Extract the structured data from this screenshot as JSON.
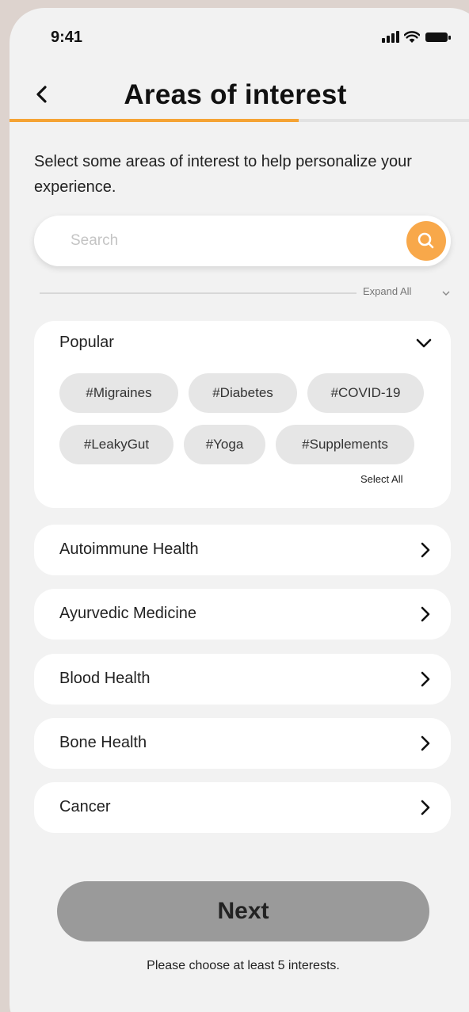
{
  "status_bar": {
    "time": "9:41"
  },
  "header": {
    "title": "Areas of interest",
    "progress": 0.63
  },
  "intro_text": "Select some areas of interest to help personalize your experience.",
  "search": {
    "placeholder": "Search",
    "value": ""
  },
  "expand_all_label": "Expand All",
  "popular": {
    "title": "Popular",
    "chips": [
      "#Migraines",
      "#Diabetes",
      "#COVID-19",
      "#LeakyGut",
      "#Yoga",
      "#Supplements"
    ],
    "select_all_label": "Select All"
  },
  "categories": [
    "Autoimmune Health",
    "Ayurvedic Medicine",
    "Blood Health",
    "Bone Health",
    "Cancer"
  ],
  "footer": {
    "next_label": "Next",
    "hint": "Please choose at least 5 interests."
  },
  "colors": {
    "accent": "#f5a334",
    "search_button": "#f8a84a",
    "chip_bg": "#e6e6e6",
    "next_button_disabled": "#9a9a9a",
    "background": "#f2f2f2"
  },
  "icons": [
    "signal-icon",
    "wifi-icon",
    "battery-icon",
    "back-arrow-icon",
    "search-icon",
    "chevron-down-icon",
    "chevron-right-icon"
  ]
}
